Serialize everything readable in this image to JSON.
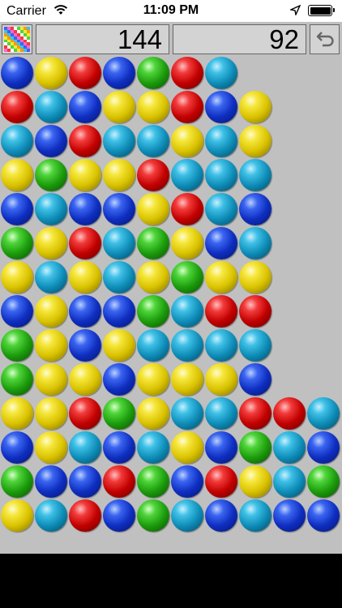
{
  "status_bar": {
    "carrier": "Carrier",
    "time": "11:09 PM"
  },
  "toolbar": {
    "score": "144",
    "moves": "92"
  },
  "palette_colors": [
    "#3a64f0",
    "#f5e63a",
    "#f23a3a",
    "#3fc0e6",
    "#4fd43a",
    "#ff66cc",
    "#ff9900",
    "#ffffff"
  ],
  "ball_colors": {
    "blue": "#1e46dc",
    "yellow": "#e8d600",
    "red": "#dc1414",
    "teal": "#1ea8d2",
    "green": "#32b41e"
  },
  "board": {
    "columns": [
      [
        "yellow",
        "green",
        "blue",
        "yellow",
        "green",
        "green",
        "blue",
        "yellow",
        "green",
        "blue",
        "yellow",
        "teal",
        "red",
        "blue"
      ],
      [
        "teal",
        "blue",
        "yellow",
        "yellow",
        "yellow",
        "yellow",
        "yellow",
        "teal",
        "yellow",
        "teal",
        "green",
        "blue",
        "teal",
        "yellow"
      ],
      [
        "red",
        "blue",
        "teal",
        "red",
        "yellow",
        "blue",
        "blue",
        "yellow",
        "red",
        "blue",
        "yellow",
        "red",
        "blue",
        "red"
      ],
      [
        "blue",
        "red",
        "blue",
        "green",
        "blue",
        "yellow",
        "blue",
        "teal",
        "teal",
        "blue",
        "yellow",
        "teal",
        "yellow",
        "blue"
      ],
      [
        "green",
        "green",
        "teal",
        "yellow",
        "yellow",
        "teal",
        "green",
        "yellow",
        "green",
        "yellow",
        "red",
        "teal",
        "yellow",
        "green"
      ],
      [
        "teal",
        "blue",
        "yellow",
        "teal",
        "yellow",
        "teal",
        "teal",
        "green",
        "yellow",
        "red",
        "teal",
        "yellow",
        "red",
        "red"
      ],
      [
        "blue",
        "red",
        "blue",
        "teal",
        "yellow",
        "teal",
        "red",
        "yellow",
        "blue",
        "teal",
        "teal",
        "teal",
        "blue",
        "teal"
      ],
      [
        "teal",
        "yellow",
        "green",
        "red",
        "blue",
        "teal",
        "red",
        "yellow",
        "teal",
        "blue",
        "teal",
        "yellow",
        "yellow"
      ],
      [
        "blue",
        "teal",
        "teal",
        "red"
      ],
      [
        "blue",
        "green",
        "blue",
        "teal"
      ]
    ]
  }
}
